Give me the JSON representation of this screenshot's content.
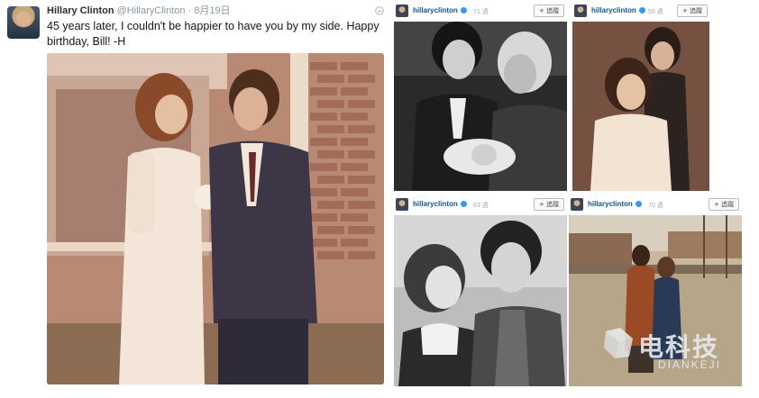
{
  "tweet": {
    "display_name": "Hillary Clinton",
    "handle": "@HillaryClinton",
    "separator": "·",
    "timestamp": "8月19日",
    "text": "45 years later, I couldn't be happier to have you by my side. Happy birthday, Bill! -H",
    "menu_icon": "caret-down-icon"
  },
  "instagram_posts": [
    {
      "username": "hillaryclinton",
      "time": "71 週",
      "follow_label": "+ 追蹤",
      "photo": "black-and-white photo of Bill and Hillary with newborn baby"
    },
    {
      "username": "hillaryclinton",
      "time": "55 週",
      "follow_label": "+ 追蹤",
      "photo": "sepia photo of young Hillary smiling with Bill behind her"
    },
    {
      "username": "hillaryclinton",
      "time": "63 週",
      "follow_label": "+ 追蹤",
      "photo": "black-and-white photo of young couple laughing outdoors"
    },
    {
      "username": "hillaryclinton",
      "time": "70 週",
      "follow_label": "+ 追蹤",
      "photo": "color photo of couple standing on a street"
    }
  ],
  "watermark": {
    "text": "电科技",
    "sub": "DIANKEJI"
  },
  "colors": {
    "link": "#125688",
    "muted": "#8899a6",
    "verified": "#3897f0"
  }
}
